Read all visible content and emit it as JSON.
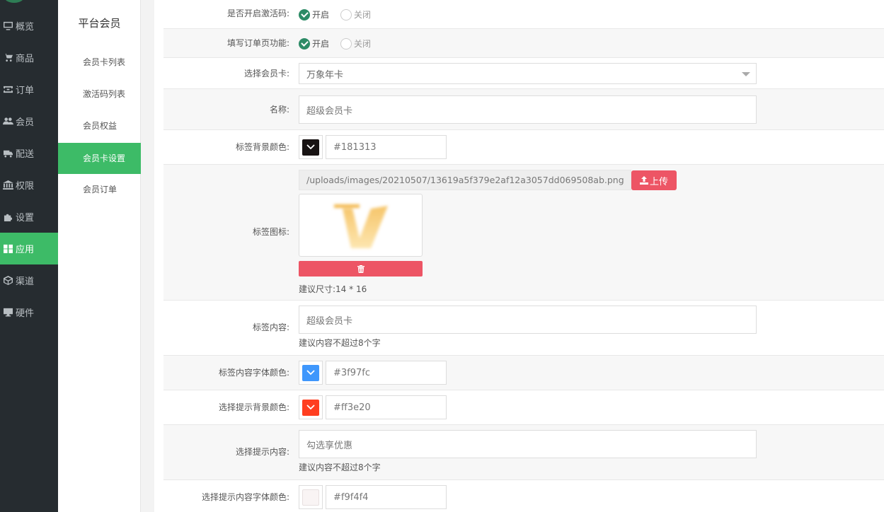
{
  "main_nav": {
    "items": [
      {
        "label": "概览",
        "icon": "monitor-icon"
      },
      {
        "label": "商品",
        "icon": "cart-icon"
      },
      {
        "label": "订单",
        "icon": "ticket-icon"
      },
      {
        "label": "会员",
        "icon": "users-icon"
      },
      {
        "label": "配送",
        "icon": "truck-icon"
      },
      {
        "label": "权限",
        "icon": "bank-icon"
      },
      {
        "label": "设置",
        "icon": "puzzle-icon"
      },
      {
        "label": "应用",
        "icon": "apps-icon"
      },
      {
        "label": "渠道",
        "icon": "cube-icon"
      },
      {
        "label": "硬件",
        "icon": "desktop-icon"
      }
    ],
    "active_index": 7
  },
  "sub_nav": {
    "title": "平台会员",
    "items": [
      "会员卡列表",
      "激活码列表",
      "会员权益",
      "会员卡设置",
      "会员订单"
    ],
    "active_index": 3
  },
  "form": {
    "activation_code": {
      "label": "是否开启激活码:",
      "on": "开启",
      "off": "关闭",
      "selected": "on"
    },
    "order_page": {
      "label": "填写订单页功能:",
      "on": "开启",
      "off": "关闭",
      "selected": "on"
    },
    "card_select": {
      "label": "选择会员卡:",
      "value": "万象年卡"
    },
    "name": {
      "label": "名称:",
      "value": "超级会员卡"
    },
    "tag_bg_color": {
      "label": "标签背景颜色:",
      "value": "#181313"
    },
    "tag_icon": {
      "label": "标签图标:",
      "path": "/uploads/images/20210507/13619a5f379e2af12a3057dd069508ab.png",
      "upload_label": "上传",
      "hint": "建议尺寸:14 * 16"
    },
    "tag_content": {
      "label": "标签内容:",
      "value": "超级会员卡",
      "hint": "建议内容不超过8个字"
    },
    "tag_font_color": {
      "label": "标签内容字体颜色:",
      "value": "#3f97fc"
    },
    "tip_bg_color": {
      "label": "选择提示背景颜色:",
      "value": "#ff3e20"
    },
    "tip_content": {
      "label": "选择提示内容:",
      "value": "勾选享优惠",
      "hint": "建议内容不超过8个字"
    },
    "tip_font_color": {
      "label": "选择提示内容字体颜色:",
      "value": "#f9f4f4"
    }
  },
  "colors": {
    "accent": "#3dbb67",
    "danger": "#ed5565",
    "radio_checked": "#2d8b66",
    "nav_bg": "#262c30"
  }
}
